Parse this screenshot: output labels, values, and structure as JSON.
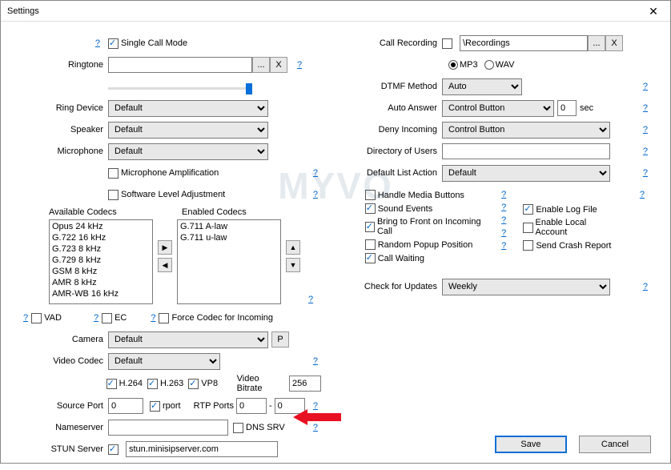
{
  "window": {
    "title": "Settings"
  },
  "left": {
    "single_call_mode": "Single Call Mode",
    "ringtone_label": "Ringtone",
    "ringtone_value": "",
    "browse": "...",
    "x": "X",
    "ring_device_label": "Ring Device",
    "ring_device_value": "Default",
    "speaker_label": "Speaker",
    "speaker_value": "Default",
    "microphone_label": "Microphone",
    "microphone_value": "Default",
    "mic_amp": "Microphone Amplification",
    "sw_level": "Software Level Adjustment",
    "available_codecs_label": "Available Codecs",
    "enabled_codecs_label": "Enabled Codecs",
    "available_codecs": [
      "Opus 24 kHz",
      "G.722 16 kHz",
      "G.723 8 kHz",
      "G.729 8 kHz",
      "GSM 8 kHz",
      "AMR 8 kHz",
      "AMR-WB 16 kHz"
    ],
    "enabled_codecs": [
      "G.711 A-law",
      "G.711 u-law"
    ],
    "vad": "VAD",
    "ec": "EC",
    "force_codec": "Force Codec for Incoming",
    "camera_label": "Camera",
    "camera_value": "Default",
    "p_btn": "P",
    "video_codec_label": "Video Codec",
    "video_codec_value": "Default",
    "h264": "H.264",
    "h263": "H.263",
    "vp8": "VP8",
    "video_bitrate_label": "Video Bitrate",
    "video_bitrate_value": "256",
    "source_port_label": "Source Port",
    "source_port_value": "0",
    "rport": "rport",
    "rtp_ports_label": "RTP Ports",
    "rtp_from": "0",
    "rtp_to": "0",
    "dash": "-",
    "nameserver_label": "Nameserver",
    "nameserver_value": "",
    "dns_srv": "DNS SRV",
    "stun_label": "STUN Server",
    "stun_value": "stun.minisipserver.com"
  },
  "right": {
    "call_recording": "Call Recording",
    "recording_path": "\\Recordings",
    "mp3": "MP3",
    "wav": "WAV",
    "dtmf_label": "DTMF Method",
    "dtmf_value": "Auto",
    "auto_answer_label": "Auto Answer",
    "auto_answer_value": "Control Button",
    "auto_answer_sec_value": "0",
    "sec": "sec",
    "deny_incoming_label": "Deny Incoming",
    "deny_incoming_value": "Control Button",
    "dir_users_label": "Directory of Users",
    "dir_users_value": "",
    "default_list_label": "Default List Action",
    "default_list_value": "Default",
    "handle_media": "Handle Media Buttons",
    "sound_events": "Sound Events",
    "bring_front": "Bring to Front on Incoming Call",
    "random_popup": "Random Popup Position",
    "call_waiting": "Call Waiting",
    "enable_log": "Enable Log File",
    "enable_local_acct": "Enable Local Account",
    "send_crash": "Send Crash Report",
    "check_updates_label": "Check for Updates",
    "check_updates_value": "Weekly"
  },
  "footer": {
    "save": "Save",
    "cancel": "Cancel"
  },
  "help": "?",
  "watermark": "MYVO"
}
